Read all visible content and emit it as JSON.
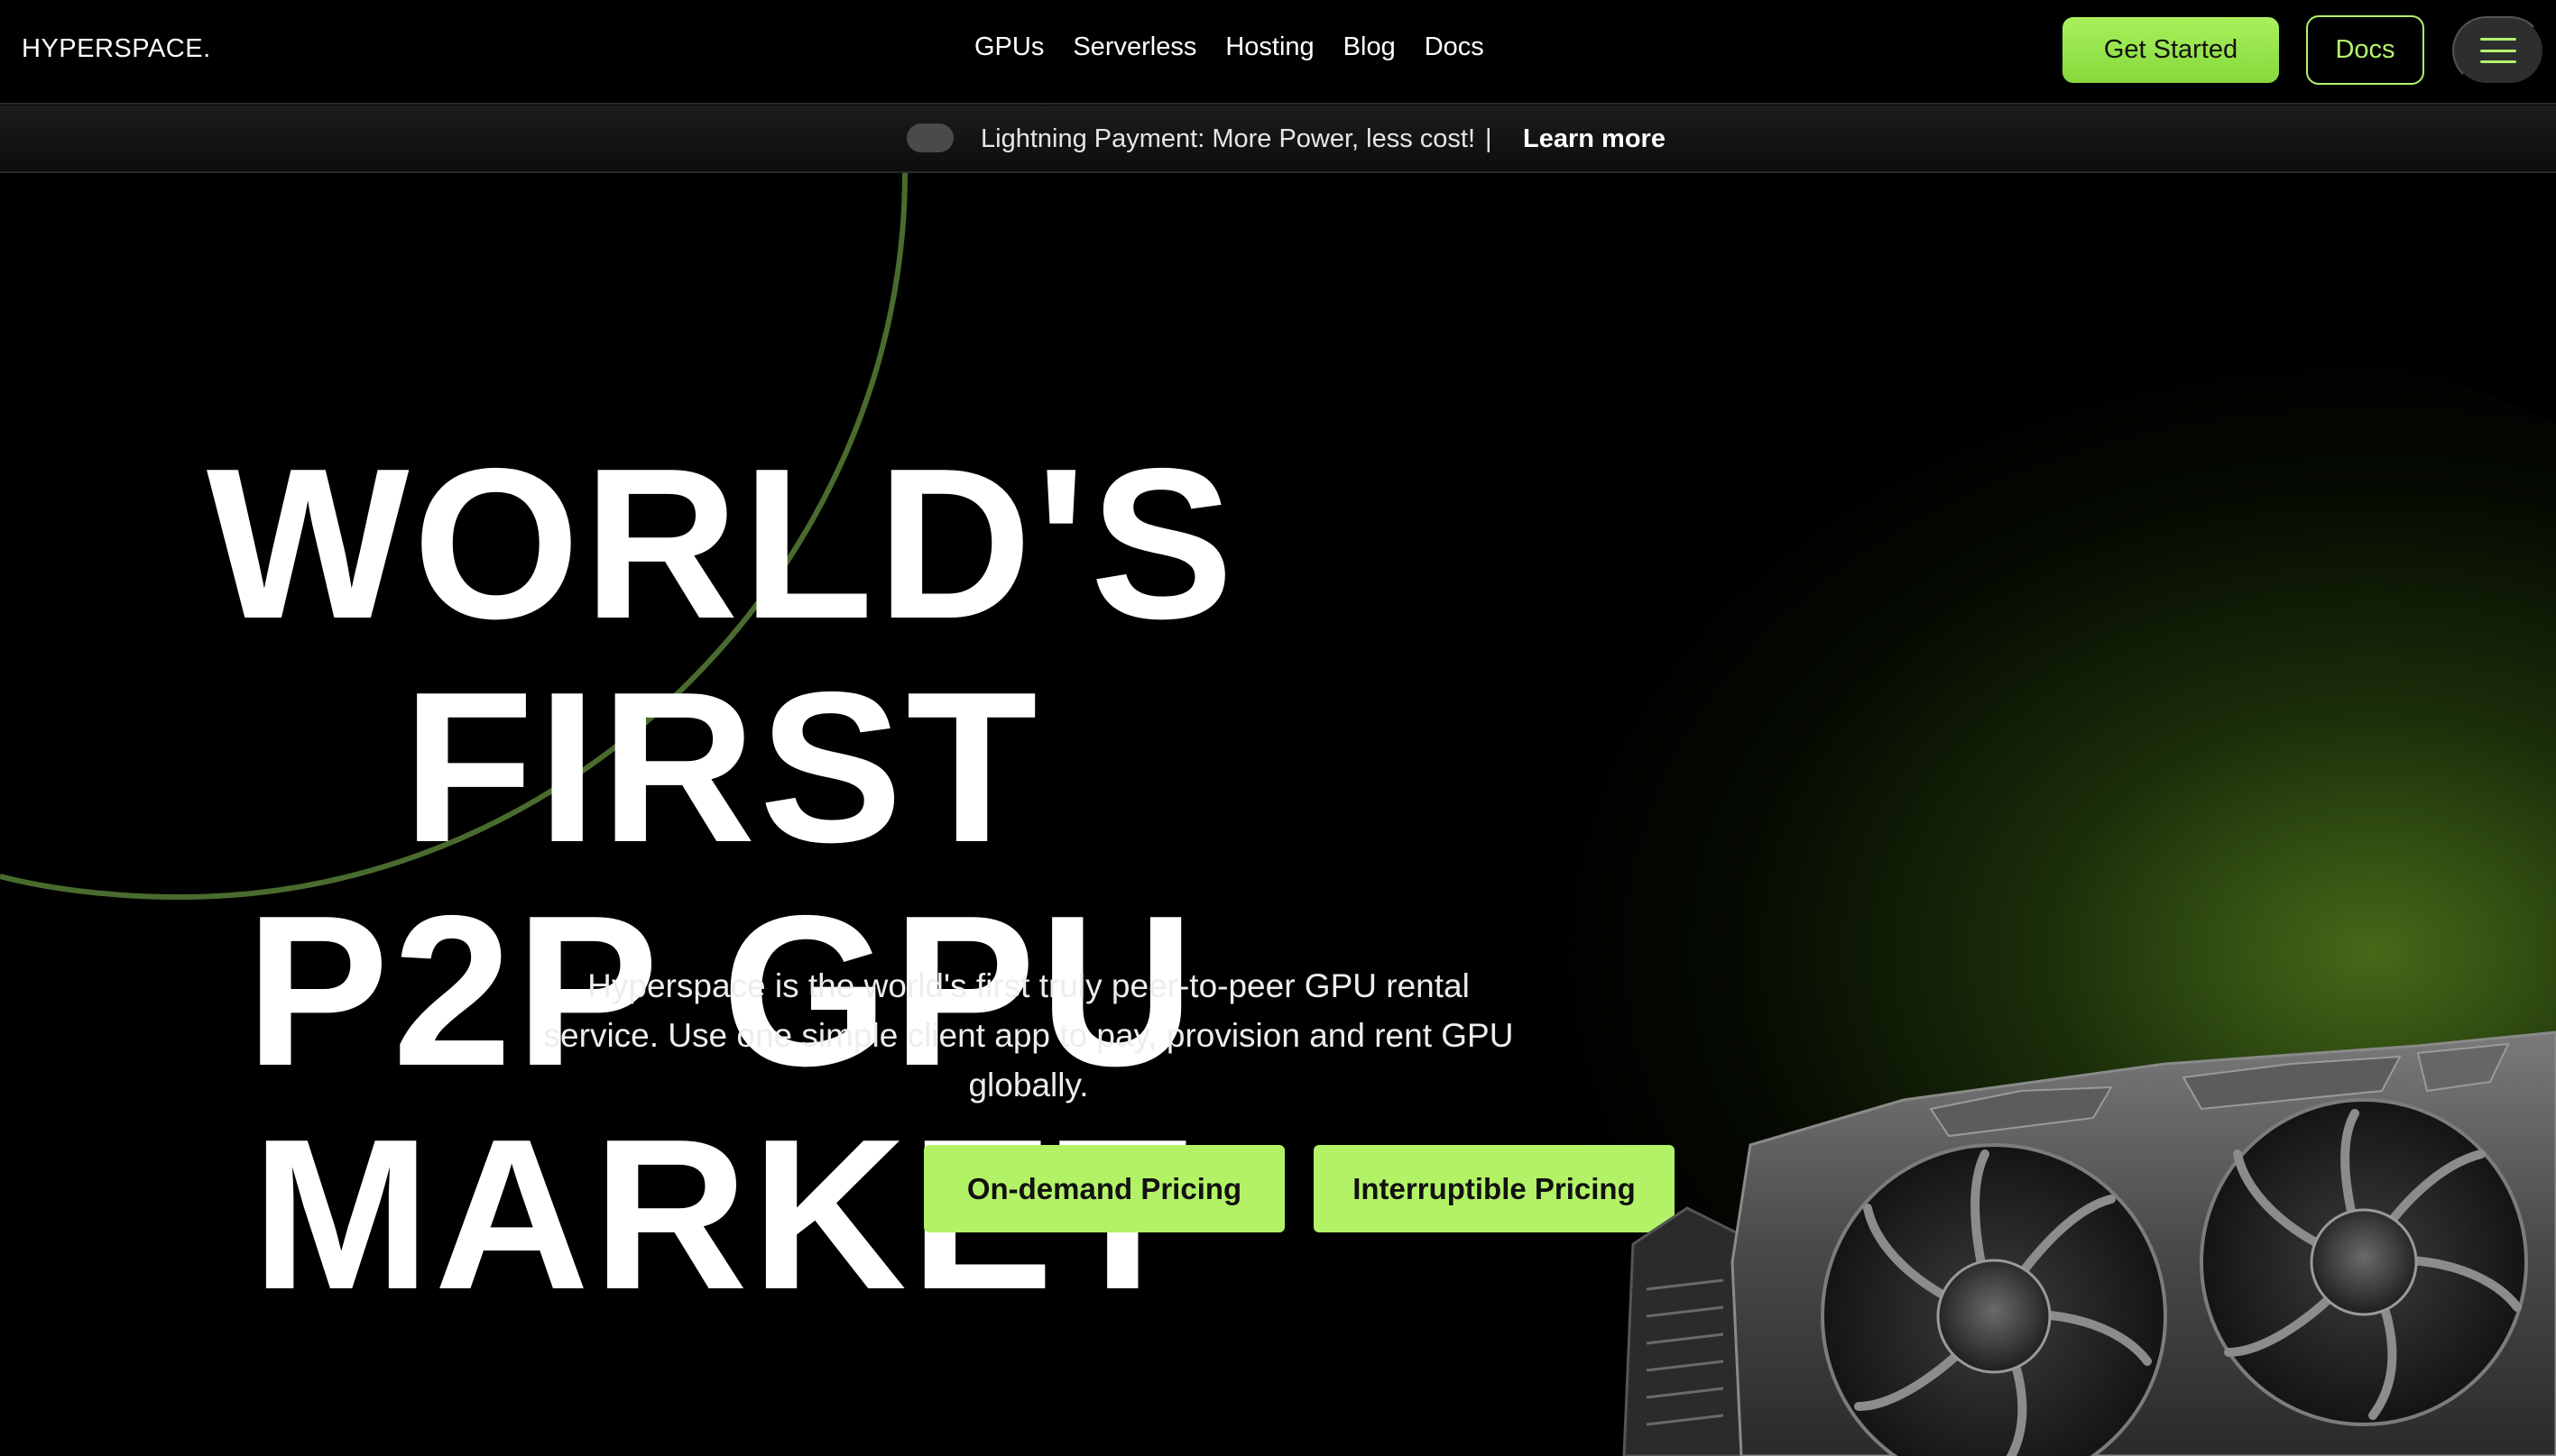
{
  "brand": {
    "logo": "HYPERSPACE.",
    "accent": "#b3f266"
  },
  "nav": {
    "links": [
      "GPUs",
      "Serverless",
      "Hosting",
      "Blog",
      "Docs"
    ],
    "get_started": "Get Started",
    "docs_button": "Docs",
    "menu_icon": "hamburger-icon"
  },
  "announcement": {
    "toggle_icon": "toggle-switch",
    "text": "Lightning Payment: More Power, less cost!",
    "separator": "|",
    "link": "Learn more"
  },
  "hero": {
    "title_line1": "WORLD'S FIRST",
    "title_line2": "P2P GPU MARKET",
    "description": "Hyperspace is the world's first truly peer-to-peer GPU rental service. Use one simple client app to pay, provision and rent GPU globally.",
    "cta_ondemand": "On-demand Pricing",
    "cta_interruptible": "Interruptible Pricing"
  }
}
